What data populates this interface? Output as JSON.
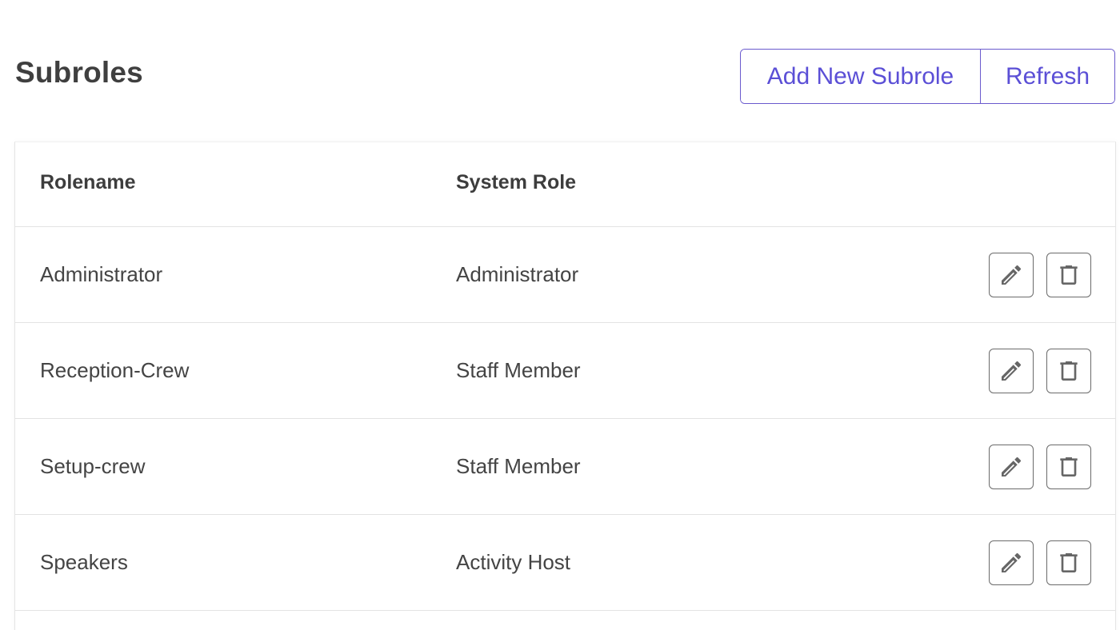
{
  "header": {
    "title": "Subroles",
    "add_button_label": "Add New Subrole",
    "refresh_button_label": "Refresh"
  },
  "table": {
    "columns": [
      "Rolename",
      "System Role"
    ],
    "rows": [
      {
        "rolename": "Administrator",
        "system_role": "Administrator"
      },
      {
        "rolename": "Reception-Crew",
        "system_role": "Staff Member"
      },
      {
        "rolename": "Setup-crew",
        "system_role": "Staff Member"
      },
      {
        "rolename": "Speakers",
        "system_role": "Activity Host"
      }
    ],
    "row_actions": [
      "pencil-icon",
      "trash-icon"
    ]
  },
  "colors": {
    "accent": "#5b4fd6",
    "text": "#424242",
    "border": "#e3e3e3"
  }
}
